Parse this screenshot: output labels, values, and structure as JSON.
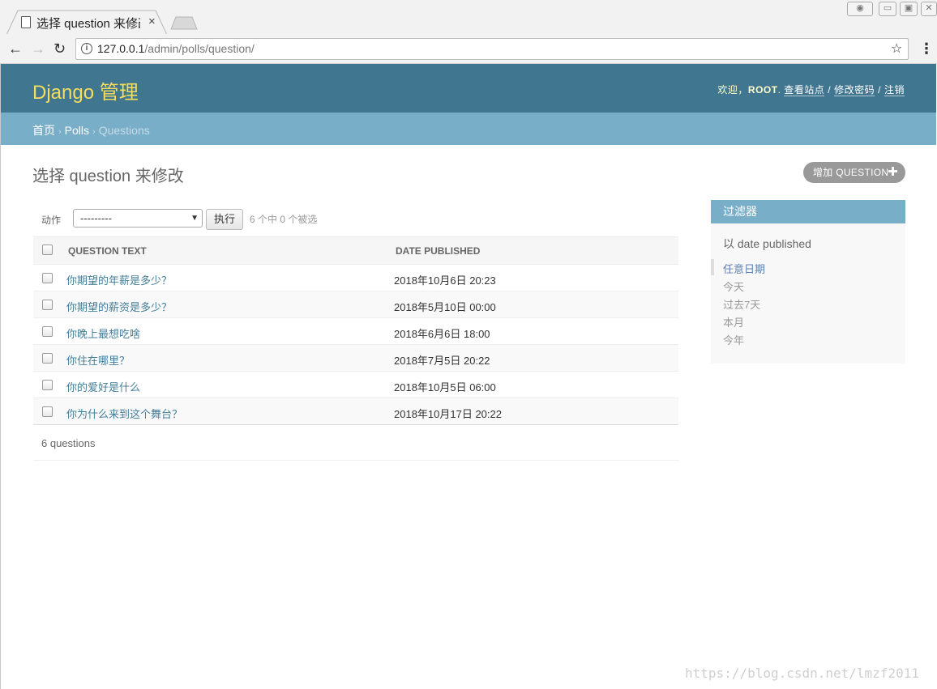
{
  "browser": {
    "tab_title": "选择 question 来修改",
    "tab_close": "×",
    "url_host": "127.0.0.1",
    "url_path": "/admin/polls/question/"
  },
  "header": {
    "branding": "Django 管理",
    "welcome": "欢迎，",
    "user": "ROOT",
    "view_site": "查看站点",
    "change_password": "修改密码",
    "logout": "注销",
    "sep": "/"
  },
  "breadcrumbs": {
    "home": "首页",
    "app": "Polls",
    "current": "Questions",
    "arrow": "›"
  },
  "page": {
    "title": "选择 question 来修改",
    "add_button": "增加 QUESTION",
    "add_plus": "✚"
  },
  "actions": {
    "label": "动作",
    "selected": "---------",
    "go": "执行",
    "counter": "6 个中 0 个被选"
  },
  "table": {
    "columns": [
      "QUESTION TEXT",
      "DATE PUBLISHED"
    ],
    "rows": [
      {
        "question": "你期望的年薪是多少？",
        "date": "2018年10月6日 20:23"
      },
      {
        "question": "你期望的薪资是多少？",
        "date": "2018年5月10日 00:00"
      },
      {
        "question": "你晚上最想吃啥",
        "date": "2018年6月6日 18:00"
      },
      {
        "question": "你住在哪里？",
        "date": "2018年7月5日 20:22"
      },
      {
        "question": "你的爱好是什么",
        "date": "2018年10月5日 06:00"
      },
      {
        "question": "你为什么来到这个舞台？",
        "date": "2018年10月17日 20:22"
      }
    ],
    "count": "6 questions"
  },
  "filter": {
    "title": "过滤器",
    "by": "以 date published",
    "options": [
      "任意日期",
      "今天",
      "过去7天",
      "本月",
      "今年"
    ],
    "selected_index": 0
  },
  "watermark": "https://blog.csdn.net/lmzf2011",
  "colors": {
    "header": "#417690",
    "breadcrumbs": "#79aec8",
    "branding": "#f5dd5d",
    "link": "#447e9b"
  }
}
